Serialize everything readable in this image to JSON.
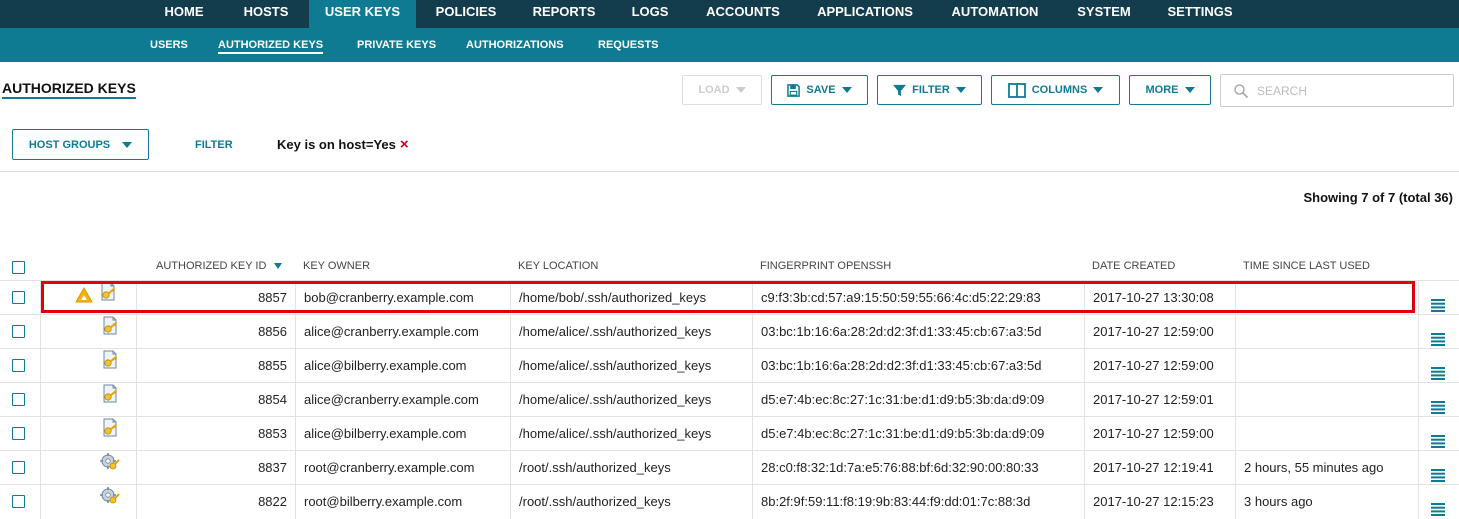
{
  "nav": {
    "items": [
      {
        "label": "HOME",
        "active": false
      },
      {
        "label": "HOSTS",
        "active": false
      },
      {
        "label": "USER KEYS",
        "active": true
      },
      {
        "label": "POLICIES",
        "active": false
      },
      {
        "label": "REPORTS",
        "active": false
      },
      {
        "label": "LOGS",
        "active": false
      },
      {
        "label": "ACCOUNTS",
        "active": false
      },
      {
        "label": "APPLICATIONS",
        "active": false
      },
      {
        "label": "AUTOMATION",
        "active": false
      },
      {
        "label": "SYSTEM",
        "active": false
      },
      {
        "label": "SETTINGS",
        "active": false
      }
    ]
  },
  "subnav": {
    "items": [
      {
        "label": "USERS",
        "active": false
      },
      {
        "label": "AUTHORIZED KEYS",
        "active": true
      },
      {
        "label": "PRIVATE KEYS",
        "active": false
      },
      {
        "label": "AUTHORIZATIONS",
        "active": false
      },
      {
        "label": "REQUESTS",
        "active": false
      }
    ]
  },
  "page": {
    "title": "AUTHORIZED KEYS"
  },
  "toolbar": {
    "load": "LOAD",
    "save": "SAVE",
    "filter": "FILTER",
    "columns": "COLUMNS",
    "more": "MORE",
    "search_placeholder": "SEARCH"
  },
  "filters": {
    "host_groups": "HOST GROUPS",
    "filter_link": "FILTER",
    "active_filter": "Key is on host=Yes",
    "remove_icon": "×"
  },
  "summary": {
    "showing": "Showing 7 of 7 (total 36)"
  },
  "table": {
    "headers": {
      "id": "AUTHORIZED KEY ID",
      "owner": "KEY OWNER",
      "location": "KEY LOCATION",
      "fingerprint": "FINGERPRINT OPENSSH",
      "date": "DATE CREATED",
      "last_used": "TIME SINCE LAST USED"
    },
    "rows": [
      {
        "warning": true,
        "key_icon": "key-file-icon",
        "id": "8857",
        "owner": "bob@cranberry.example.com",
        "location": "/home/bob/.ssh/authorized_keys",
        "fingerprint": "c9:f3:3b:cd:57:a9:15:50:59:55:66:4c:d5:22:29:83",
        "date": "2017-10-27 13:30:08",
        "last_used": "",
        "highlighted": true
      },
      {
        "warning": false,
        "key_icon": "key-file-icon",
        "id": "8856",
        "owner": "alice@cranberry.example.com",
        "location": "/home/alice/.ssh/authorized_keys",
        "fingerprint": "03:bc:1b:16:6a:28:2d:d2:3f:d1:33:45:cb:67:a3:5d",
        "date": "2017-10-27 12:59:00",
        "last_used": "",
        "highlighted": false
      },
      {
        "warning": false,
        "key_icon": "key-file-icon",
        "id": "8855",
        "owner": "alice@bilberry.example.com",
        "location": "/home/alice/.ssh/authorized_keys",
        "fingerprint": "03:bc:1b:16:6a:28:2d:d2:3f:d1:33:45:cb:67:a3:5d",
        "date": "2017-10-27 12:59:00",
        "last_used": "",
        "highlighted": false
      },
      {
        "warning": false,
        "key_icon": "key-file-icon",
        "id": "8854",
        "owner": "alice@cranberry.example.com",
        "location": "/home/alice/.ssh/authorized_keys",
        "fingerprint": "d5:e7:4b:ec:8c:27:1c:31:be:d1:d9:b5:3b:da:d9:09",
        "date": "2017-10-27 12:59:01",
        "last_used": "",
        "highlighted": false
      },
      {
        "warning": false,
        "key_icon": "key-file-icon",
        "id": "8853",
        "owner": "alice@bilberry.example.com",
        "location": "/home/alice/.ssh/authorized_keys",
        "fingerprint": "d5:e7:4b:ec:8c:27:1c:31:be:d1:d9:b5:3b:da:d9:09",
        "date": "2017-10-27 12:59:00",
        "last_used": "",
        "highlighted": false
      },
      {
        "warning": false,
        "key_icon": "key-gear-icon",
        "id": "8837",
        "owner": "root@cranberry.example.com",
        "location": "/root/.ssh/authorized_keys",
        "fingerprint": "28:c0:f8:32:1d:7a:e5:76:88:bf:6d:32:90:00:80:33",
        "date": "2017-10-27 12:19:41",
        "last_used": "2 hours, 55 minutes ago",
        "highlighted": false
      },
      {
        "warning": false,
        "key_icon": "key-gear-icon",
        "id": "8822",
        "owner": "root@bilberry.example.com",
        "location": "/root/.ssh/authorized_keys",
        "fingerprint": "8b:2f:9f:59:11:f8:19:9b:83:44:f9:dd:01:7c:88:3d",
        "date": "2017-10-27 12:15:23",
        "last_used": "3 hours ago",
        "highlighted": false
      }
    ]
  },
  "colors": {
    "nav_bg": "#133d4d",
    "accent": "#0e7b92",
    "highlight": "#e3000b",
    "warning": "#f5b400"
  }
}
